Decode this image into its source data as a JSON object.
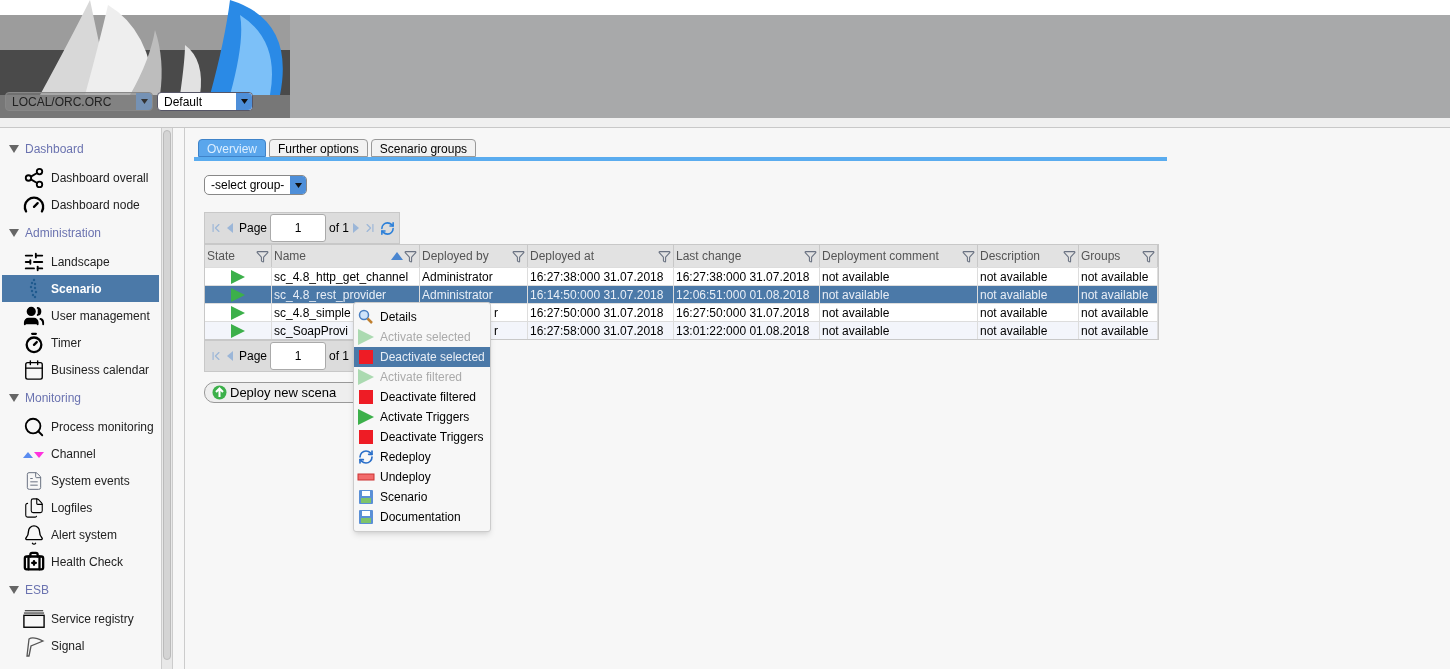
{
  "header": {
    "server_select": {
      "value": "LOCAL/ORC.ORC"
    },
    "profile_select": {
      "value": "Default"
    }
  },
  "sidebar": {
    "sections": [
      {
        "title": "Dashboard",
        "expanded": true,
        "items": [
          {
            "label": "Dashboard overall",
            "selected": false
          },
          {
            "label": "Dashboard node",
            "selected": false
          }
        ]
      },
      {
        "title": "Administration",
        "expanded": true,
        "items": [
          {
            "label": "Landscape",
            "selected": false
          },
          {
            "label": "Scenario",
            "selected": true
          },
          {
            "label": "User management",
            "selected": false
          },
          {
            "label": "Timer",
            "selected": false
          },
          {
            "label": "Business calendar",
            "selected": false
          }
        ]
      },
      {
        "title": "Monitoring",
        "expanded": true,
        "items": [
          {
            "label": "Process monitoring",
            "selected": false
          },
          {
            "label": "Channel",
            "selected": false
          },
          {
            "label": "System events",
            "selected": false
          },
          {
            "label": "Logfiles",
            "selected": false
          },
          {
            "label": "Alert system",
            "selected": false
          },
          {
            "label": "Health Check",
            "selected": false
          }
        ]
      },
      {
        "title": "ESB",
        "expanded": true,
        "items": [
          {
            "label": "Service registry",
            "selected": false
          },
          {
            "label": "Signal",
            "selected": false
          }
        ]
      }
    ]
  },
  "tabs": [
    {
      "label": "Overview",
      "selected": true
    },
    {
      "label": "Further options",
      "selected": false
    },
    {
      "label": "Scenario groups",
      "selected": false
    }
  ],
  "group_select": {
    "value": "-select group-"
  },
  "pager_top": {
    "label": "Page",
    "page": "1",
    "of": "of 1"
  },
  "table": {
    "columns": [
      {
        "label": "State",
        "sorted": false
      },
      {
        "label": "Name",
        "sorted": true
      },
      {
        "label": "Deployed by",
        "sorted": false
      },
      {
        "label": "Deployed at",
        "sorted": false
      },
      {
        "label": "Last change",
        "sorted": false
      },
      {
        "label": "Deployment comment",
        "sorted": false
      },
      {
        "label": "Description",
        "sorted": false
      },
      {
        "label": "Groups",
        "sorted": false
      }
    ],
    "rows": [
      {
        "selected": false,
        "covered": false,
        "cells": [
          "",
          "sc_4.8_http_get_channel",
          "Administrator",
          "16:27:38:000 31.07.2018",
          "16:27:38:000 31.07.2018",
          "not available",
          "not available",
          "not available"
        ]
      },
      {
        "selected": true,
        "covered": false,
        "cells": [
          "",
          "sc_4.8_rest_provider",
          "Administrator",
          "16:14:50:000 31.07.2018",
          "12:06:51:000 01.08.2018",
          "not available",
          "not available",
          "not available"
        ]
      },
      {
        "selected": false,
        "covered": true,
        "cells": [
          "",
          "sc_4.8_simple",
          "r",
          "16:27:50:000 31.07.2018",
          "16:27:50:000 31.07.2018",
          "not available",
          "not available",
          "not available"
        ]
      },
      {
        "selected": false,
        "covered": true,
        "cells": [
          "",
          "sc_SoapProvi",
          "r",
          "16:27:58:000 31.07.2018",
          "13:01:22:000 01.08.2018",
          "not available",
          "not available",
          "not available"
        ]
      }
    ]
  },
  "pager_bottom": {
    "label": "Page",
    "page": "1",
    "of": "of 1"
  },
  "deploy_button": {
    "label": "Deploy new scena"
  },
  "context_menu": {
    "items": [
      {
        "label": "Details",
        "disabled": false,
        "selected": false
      },
      {
        "label": "Activate selected",
        "disabled": true,
        "selected": false
      },
      {
        "label": "Deactivate selected",
        "disabled": false,
        "selected": true
      },
      {
        "label": "Activate filtered",
        "disabled": true,
        "selected": false
      },
      {
        "label": "Deactivate filtered",
        "disabled": false,
        "selected": false
      },
      {
        "label": "Activate Triggers",
        "disabled": false,
        "selected": false
      },
      {
        "label": "Deactivate Triggers",
        "disabled": false,
        "selected": false
      },
      {
        "label": "Redeploy",
        "disabled": false,
        "selected": false
      },
      {
        "label": "Undeploy",
        "disabled": false,
        "selected": false
      },
      {
        "label": "Scenario",
        "disabled": false,
        "selected": false
      },
      {
        "label": "Documentation",
        "disabled": false,
        "selected": false
      }
    ]
  }
}
